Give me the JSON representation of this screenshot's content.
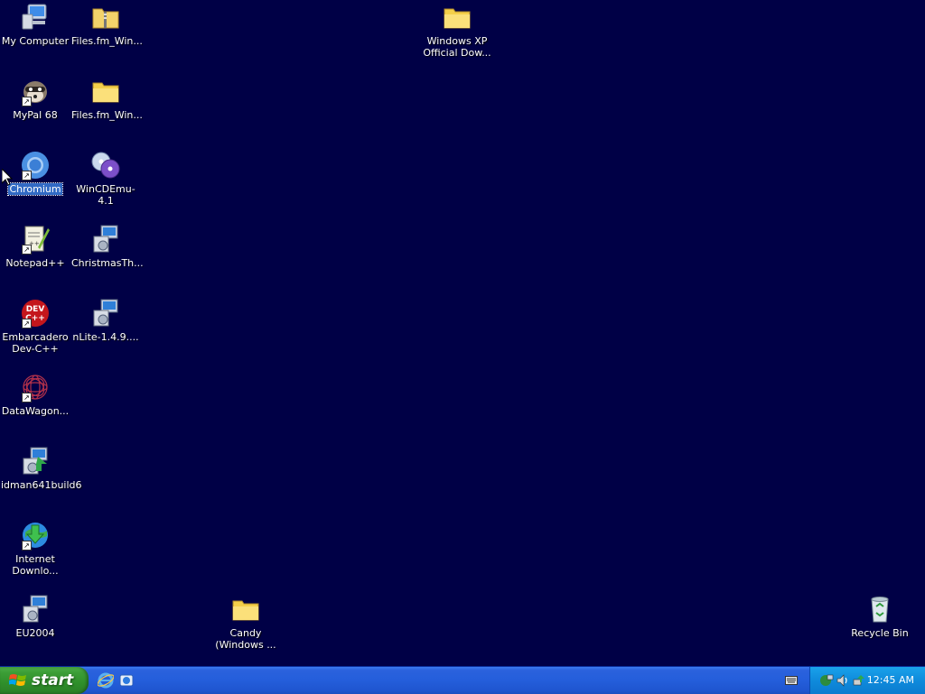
{
  "desktop": {
    "icons": {
      "my_computer": "My Computer",
      "files_fm_1": "Files.fm_Win...",
      "windows_xp_download": "Windows XP Official Dow...",
      "mypal": "MyPal 68",
      "files_fm_2": "Files.fm_Win...",
      "chromium": "Chromium",
      "wincdemu": "WinCDEmu-4.1",
      "notepadpp": "Notepad++",
      "christmas": "ChristmasTh...",
      "devcpp": "Embarcadero Dev-C++",
      "nlite": "nLite-1.4.9....",
      "datawagon": "DataWagon...",
      "idman": "idman641build6",
      "internet_download": "Internet Downlo...",
      "eu2004": "EU2004",
      "candy": "Candy (Windows ...",
      "recycle_bin": "Recycle Bin"
    }
  },
  "taskbar": {
    "start_label": "start",
    "clock": "12:45 AM"
  }
}
